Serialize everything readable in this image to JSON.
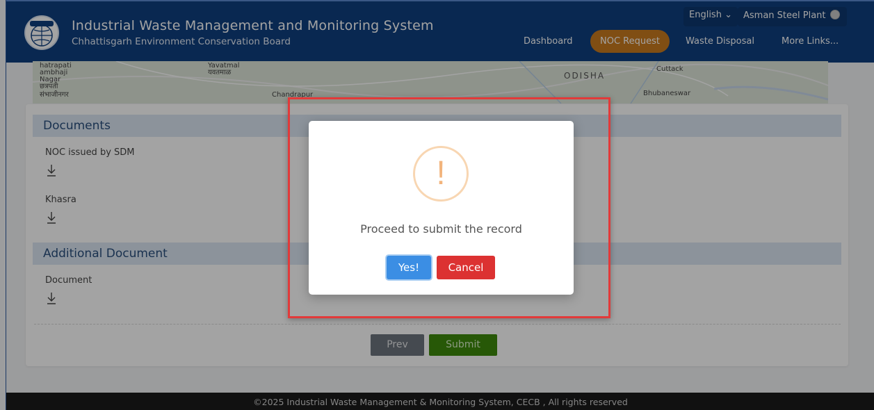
{
  "header": {
    "title": "Industrial Waste Management and Monitoring System",
    "subtitle": "Chhattisgarh Environment Conservation Board",
    "language": "English",
    "language_caret": "⌄",
    "user": "Asman Steel Plant",
    "nav": [
      {
        "label": "Dashboard"
      },
      {
        "label": "NOC Request"
      },
      {
        "label": "Waste Disposal"
      },
      {
        "label": "More Links..."
      }
    ],
    "active_nav": "NOC Request"
  },
  "map": {
    "labels": {
      "l1": "hatrapati",
      "l2": "ambhaji",
      "l3": "Nagar",
      "l4": "छत्रपती",
      "l5": "संभाजीनगर",
      "l6": "Yavatmal",
      "l7": "यवतमाळ",
      "l8": "Chandrapur",
      "l9": "ODISHA",
      "l10": "Cuttack",
      "l11": "Bhubaneswar"
    }
  },
  "documents": {
    "heading": "Documents",
    "items": [
      {
        "label": "NOC issued by SDM"
      },
      {
        "label": "Khasra"
      }
    ]
  },
  "additional": {
    "heading": "Additional Document",
    "items": [
      {
        "label": "Document"
      }
    ]
  },
  "actions": {
    "prev": "Prev",
    "submit": "Submit"
  },
  "footer": {
    "text": "©2025 Industrial Waste Management & Monitoring System, CECB , All rights reserved"
  },
  "dialog": {
    "icon_glyph": "!",
    "message": "Proceed to submit the record",
    "confirm": "Yes!",
    "cancel": "Cancel"
  },
  "colors": {
    "header": "#0f3f7f",
    "active_nav": "#c97a1f",
    "confirm": "#3b8ee4",
    "cancel": "#dc3232",
    "submit": "#3d8a0b",
    "highlight": "#e23a3a"
  }
}
